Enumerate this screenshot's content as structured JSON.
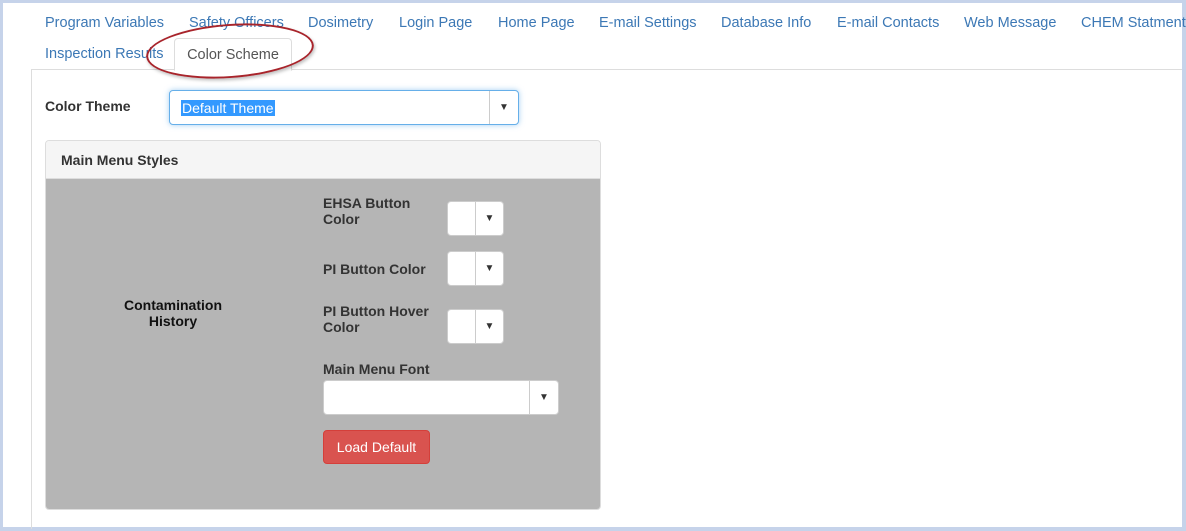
{
  "tabs": {
    "row1": [
      "Program Variables",
      "Safety Officers",
      "Dosimetry",
      "Login Page",
      "Home Page",
      "E-mail Settings",
      "Database Info",
      "E-mail Contacts",
      "Web Message",
      "CHEM Statment"
    ],
    "row2": [
      "Inspection Results",
      "Color Scheme"
    ],
    "active": "Color Scheme"
  },
  "color_theme": {
    "label": "Color Theme",
    "value": "Default Theme"
  },
  "panel": {
    "title": "Main Menu Styles",
    "preview_text": "Contamination History",
    "ehsa_button_color_label": "EHSA Button Color",
    "pi_button_color_label": "PI Button Color",
    "pi_button_hover_color_label": "PI Button Hover Color",
    "main_menu_font_label": "Main Menu Font",
    "main_menu_font_value": "",
    "load_default_label": "Load Default"
  },
  "colors": {
    "link": "#3c78b5",
    "danger": "#d9534f",
    "panel_body": "#b5b5b5",
    "annotation": "#a8242b"
  },
  "icons": {
    "caret": "caret-down-icon"
  }
}
